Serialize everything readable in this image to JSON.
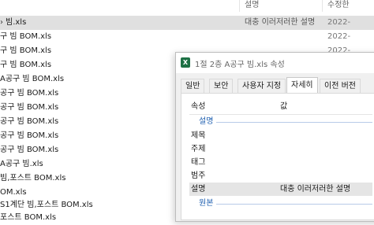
{
  "explorer": {
    "headers": {
      "description": "설명",
      "modified": "수정한"
    },
    "files": [
      {
        "name": "빔.xls",
        "description": "대충 이러저러한 설명",
        "date": "2022-",
        "selected": true,
        "arrow": true
      },
      {
        "name": "구 빔 BOM.xls",
        "description": "",
        "date": "2022-"
      },
      {
        "name": "구 빔 BOM.xls",
        "description": "",
        "date": "2022-"
      },
      {
        "name": "구 빔 BOM.xls",
        "description": "",
        "date": ""
      },
      {
        "name": "A공구 빔 BOM.xls",
        "description": "",
        "date": ""
      },
      {
        "name": "공구 빔 BOM.xls",
        "description": "",
        "date": ""
      },
      {
        "name": "공구 빔 BOM.xls",
        "description": "",
        "date": ""
      },
      {
        "name": "공구 빔 BOM.xls",
        "description": "",
        "date": ""
      },
      {
        "name": "공구 빔 BOM.xls",
        "description": "",
        "date": ""
      },
      {
        "name": "공구 빔 BOM.xls",
        "description": "",
        "date": ""
      },
      {
        "name": "A공구 빔.xls",
        "description": "",
        "date": ""
      },
      {
        "name": "빔,포스트 BOM.xls",
        "description": "",
        "date": ""
      },
      {
        "name": "OM.xls",
        "description": "",
        "date": ""
      },
      {
        "name": "S1계단 빔,포스트 BOM.xls",
        "description": "",
        "date": ""
      },
      {
        "name": "포스트 BOM.xls",
        "description": "",
        "date": ""
      }
    ]
  },
  "dialog": {
    "title": "1절 2층 A공구 빔.xls 속성",
    "app_icon": "excel-icon",
    "tabs": [
      "일반",
      "보안",
      "사용자 지정",
      "자세히",
      "이전 버전"
    ],
    "active_tab": "자세히",
    "table": {
      "header_property": "속성",
      "header_value": "값",
      "group_description": "설명",
      "rows": [
        {
          "property": "제목",
          "value": ""
        },
        {
          "property": "주제",
          "value": ""
        },
        {
          "property": "태그",
          "value": ""
        },
        {
          "property": "범주",
          "value": ""
        },
        {
          "property": "설명",
          "value": "대충 이러저러한 설명",
          "highlight": true
        }
      ],
      "group_origin": "원본"
    }
  },
  "colors": {
    "group_label": "#2060b0",
    "selection": "#e0e0e0",
    "excel_green": "#1e7145"
  }
}
